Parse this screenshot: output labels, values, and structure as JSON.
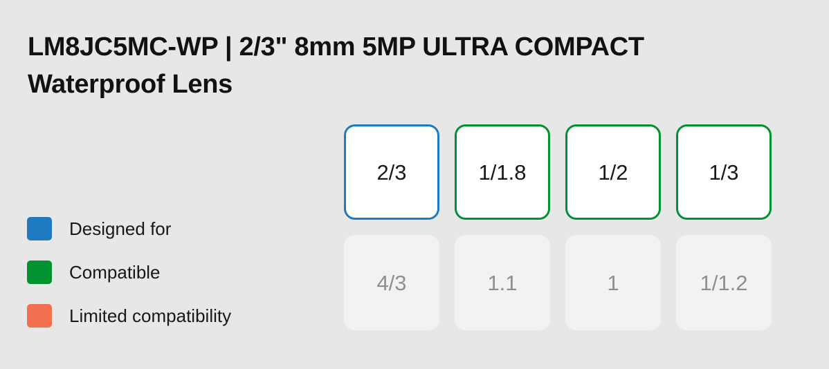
{
  "header": {
    "title": "LM8JC5MC-WP | 2/3\" 8mm 5MP ULTRA COMPACT Waterproof Lens"
  },
  "colors": {
    "background": "#e7e7e7",
    "designed_for": "#1f7ac0",
    "compatible": "#009130",
    "limited_compatibility": "#f2704f",
    "card_active_bg": "#ffffff",
    "card_inactive_bg": "#f2f2f2",
    "card_active_text": "#16181c",
    "card_inactive_text": "#8f8f8f"
  },
  "legend": {
    "items": [
      {
        "label": "Designed for",
        "color": "#1f7ac0",
        "status": "designed"
      },
      {
        "label": "Compatible",
        "color": "#009130",
        "status": "compatible"
      },
      {
        "label": "Limited compatibility",
        "color": "#f2704f",
        "status": "limited"
      }
    ]
  },
  "sensor_grid": {
    "rows": 2,
    "columns": 4,
    "cards": [
      {
        "label": "2/3",
        "status": "designed",
        "state": "active"
      },
      {
        "label": "1/1.8",
        "status": "compatible",
        "state": "active"
      },
      {
        "label": "1/2",
        "status": "compatible",
        "state": "active"
      },
      {
        "label": "1/3",
        "status": "compatible",
        "state": "active"
      },
      {
        "label": "4/3",
        "status": "none",
        "state": "inactive"
      },
      {
        "label": "1.1",
        "status": "none",
        "state": "inactive"
      },
      {
        "label": "1",
        "status": "none",
        "state": "inactive"
      },
      {
        "label": "1/1.2",
        "status": "none",
        "state": "inactive"
      }
    ]
  }
}
